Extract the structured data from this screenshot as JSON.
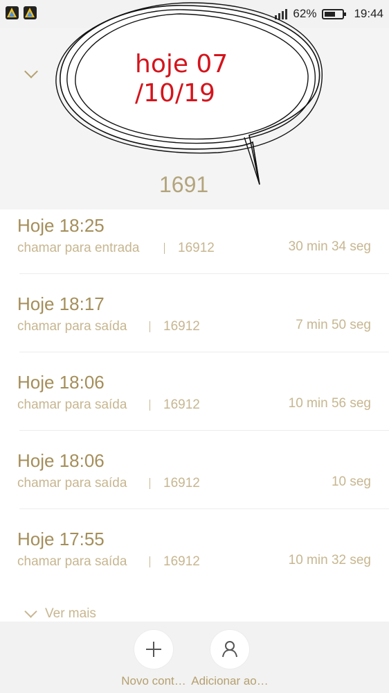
{
  "status_bar": {
    "battery_percent": "62%",
    "time": "19:44",
    "battery_level": 0.62,
    "icons": [
      "app-notification-icon",
      "app-notification-icon",
      "signal-icon",
      "battery-icon"
    ]
  },
  "header": {
    "collapse_icon": "chevron-down-icon",
    "contact_number_partial": "1691"
  },
  "annotation": {
    "line1": "hoje 07",
    "line2": "/10/19",
    "color": "#d4141c"
  },
  "calls": [
    {
      "time": "Hoje 18:25",
      "type": "chamar para entrada",
      "number": "16912",
      "duration": "30 min 34 seg"
    },
    {
      "time": "Hoje 18:17",
      "type": "chamar para saída",
      "number": "16912",
      "duration": "7 min 50 seg"
    },
    {
      "time": "Hoje 18:06",
      "type": "chamar para saída",
      "number": "16912",
      "duration": "10 min 56 seg"
    },
    {
      "time": "Hoje 18:06",
      "type": "chamar para saída",
      "number": "16912",
      "duration": "10 seg"
    },
    {
      "time": "Hoje 17:55",
      "type": "chamar para saída",
      "number": "16912",
      "duration": "10 min 32 seg"
    }
  ],
  "see_more": {
    "label": "Ver mais"
  },
  "actions": {
    "new_contact": {
      "label": "Novo cont…",
      "icon": "plus-icon"
    },
    "add_to": {
      "label": "Adicionar ao…",
      "icon": "person-icon"
    }
  },
  "colors": {
    "accent": "#a48e5a",
    "accent_light": "#c7b690",
    "header_bg": "#f4f4f4"
  }
}
